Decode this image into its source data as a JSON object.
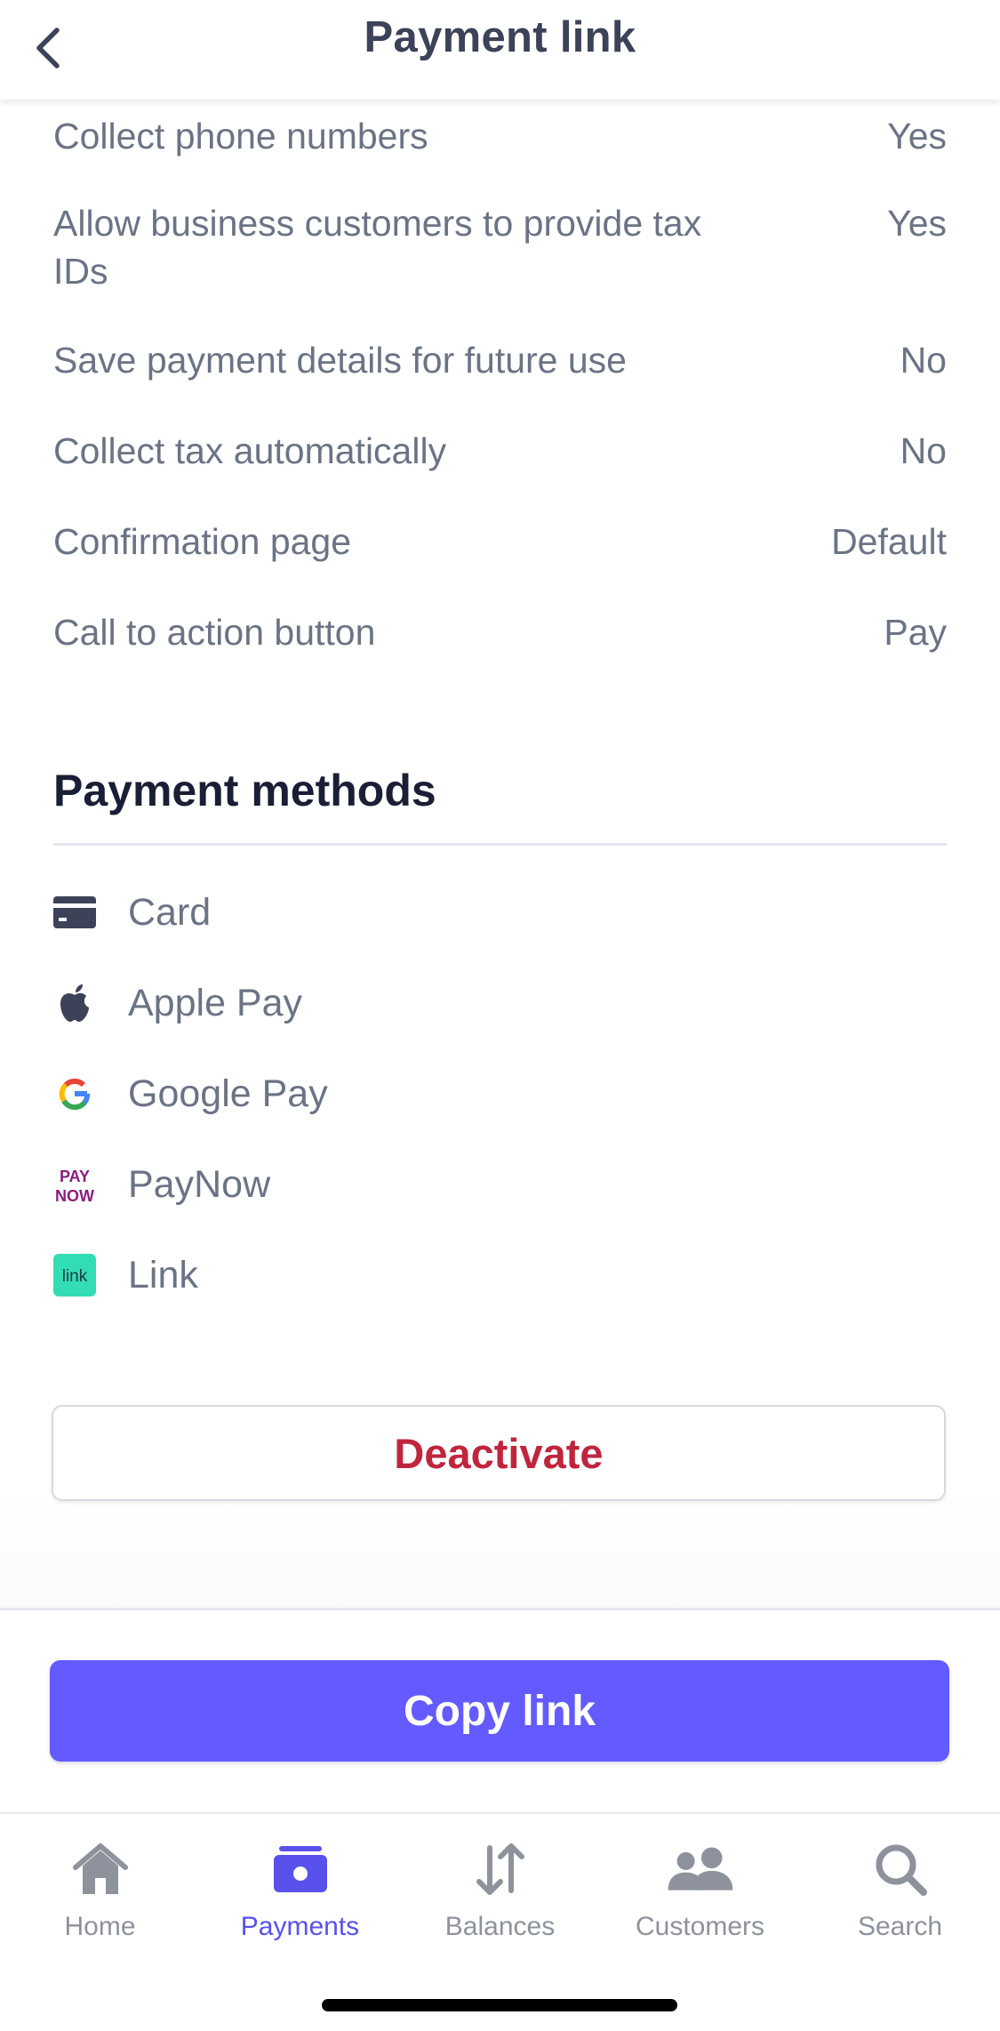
{
  "header": {
    "title": "Payment link"
  },
  "settings": [
    {
      "label": "Collect phone numbers",
      "value": "Yes"
    },
    {
      "label": "Allow business customers to provide tax IDs",
      "value": "Yes"
    },
    {
      "label": "Save payment details for future use",
      "value": "No"
    },
    {
      "label": "Collect tax automatically",
      "value": "No"
    },
    {
      "label": "Confirmation page",
      "value": "Default"
    },
    {
      "label": "Call to action button",
      "value": "Pay"
    }
  ],
  "payment_methods": {
    "title": "Payment methods",
    "items": [
      {
        "label": "Card",
        "icon": "card-icon"
      },
      {
        "label": "Apple Pay",
        "icon": "apple-icon"
      },
      {
        "label": "Google Pay",
        "icon": "google-icon"
      },
      {
        "label": "PayNow",
        "icon": "paynow-icon",
        "icon_text_top": "PAY",
        "icon_text_bottom": "NOW"
      },
      {
        "label": "Link",
        "icon": "link-icon",
        "icon_text": "link"
      }
    ]
  },
  "actions": {
    "deactivate_label": "Deactivate",
    "copy_label": "Copy link"
  },
  "tabs": [
    {
      "label": "Home",
      "icon": "home-icon",
      "active": false
    },
    {
      "label": "Payments",
      "icon": "payments-icon",
      "active": true
    },
    {
      "label": "Balances",
      "icon": "balances-icon",
      "active": false
    },
    {
      "label": "Customers",
      "icon": "customers-icon",
      "active": false
    },
    {
      "label": "Search",
      "icon": "search-icon",
      "active": false
    }
  ],
  "colors": {
    "accent": "#635bff",
    "danger": "#c0253e",
    "tab_active": "#5851ec",
    "tab_inactive": "#8d929c",
    "heading": "#1a1f36",
    "text": "#6b7385"
  }
}
